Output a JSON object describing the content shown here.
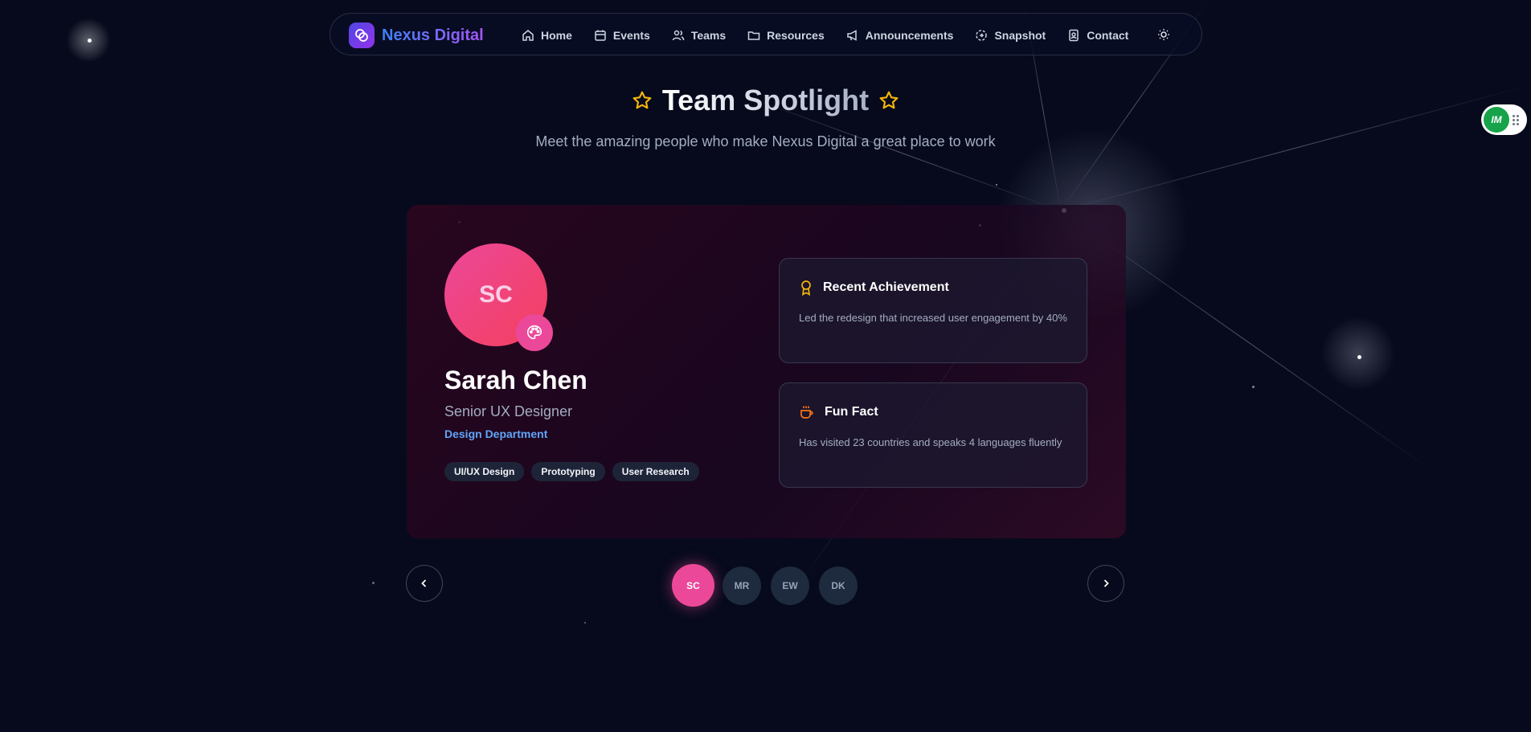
{
  "brand": {
    "name": "Nexus Digital"
  },
  "nav": {
    "items": [
      {
        "label": "Home",
        "icon": "home-icon"
      },
      {
        "label": "Events",
        "icon": "calendar-icon"
      },
      {
        "label": "Teams",
        "icon": "users-icon"
      },
      {
        "label": "Resources",
        "icon": "folder-icon"
      },
      {
        "label": "Announcements",
        "icon": "megaphone-icon"
      },
      {
        "label": "Snapshot",
        "icon": "snapshot-icon"
      },
      {
        "label": "Contact",
        "icon": "contact-icon"
      }
    ],
    "theme_toggle_icon": "sun-icon"
  },
  "header": {
    "title": "Team Spotlight",
    "subtitle": "Meet the amazing people who make Nexus Digital a great place to work"
  },
  "spotlight": {
    "initials": "SC",
    "badge_icon": "palette-icon",
    "name": "Sarah Chen",
    "role": "Senior UX Designer",
    "department": "Design Department",
    "skills": [
      "UI/UX Design",
      "Prototyping",
      "User Research"
    ],
    "achievement": {
      "title": "Recent Achievement",
      "text": "Led the redesign that increased user engagement by 40%"
    },
    "fun_fact": {
      "title": "Fun Fact",
      "text": "Has visited 23 countries and speaks 4 languages fluently"
    }
  },
  "carousel": {
    "members": [
      "SC",
      "MR",
      "EW",
      "DK"
    ],
    "active_index": 0
  },
  "widget": {
    "label": "IM"
  },
  "colors": {
    "accent_pink": "#ec4899",
    "brand_blue": "#3b82f6",
    "brand_purple": "#a855f7",
    "department_blue": "#60a5fa",
    "star_gold": "#f5b50a",
    "background": "#060a1c"
  }
}
